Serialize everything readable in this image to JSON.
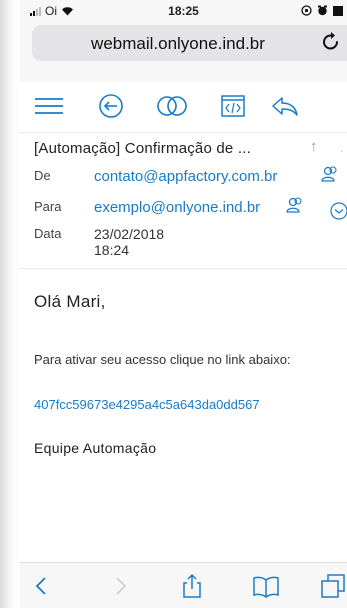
{
  "status": {
    "carrier": "Oi",
    "time": "18:25"
  },
  "browser": {
    "url": "webmail.onlyone.ind.br",
    "reload_icon": "reload-icon"
  },
  "toolbar": {
    "icons": [
      "menu-icon",
      "back-circle-icon",
      "toggle-icon",
      "source-code-icon",
      "reply-icon"
    ],
    "accent": "#1a7bc8"
  },
  "email": {
    "subject": "[Automação] Confirmação de ...",
    "from_label": "De",
    "from": "contato@appfactory.com.br",
    "to_label": "Para",
    "to": "exemplo@onlyone.ind.br",
    "date_label": "Data",
    "date": "23/02/2018 18:24"
  },
  "body": {
    "greeting": "Olá Mari,",
    "paragraph": "Para ativar seu acesso clique no link abaixo:",
    "link": "407fcc59673e4295a4c5a643da0dd567",
    "signature": "Equipe Automação"
  },
  "bottom_bar": {
    "icons": [
      "back-icon",
      "forward-icon",
      "share-icon",
      "bookmarks-icon",
      "tabs-icon"
    ]
  }
}
